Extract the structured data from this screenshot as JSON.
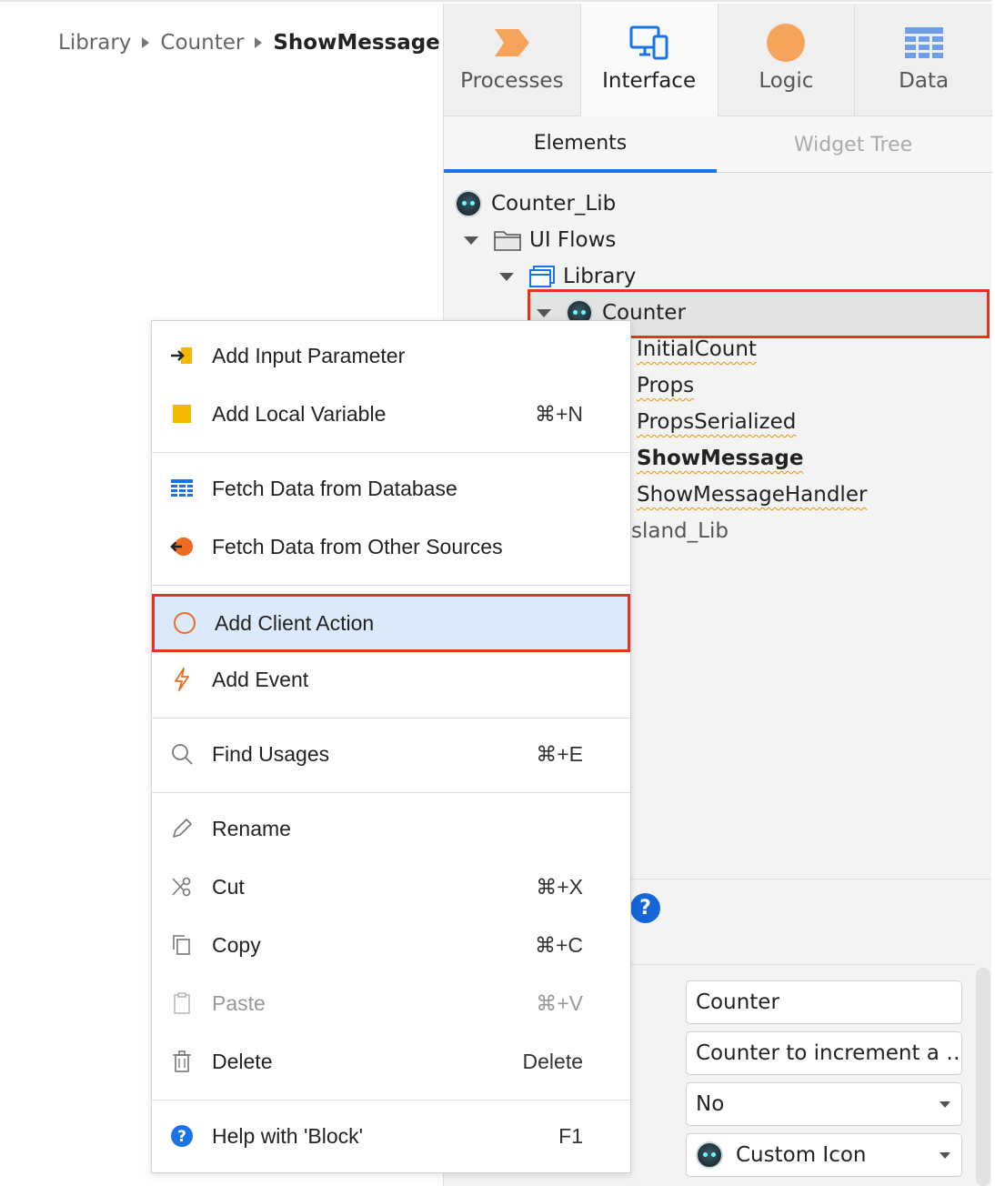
{
  "breadcrumb": {
    "items": [
      "Library",
      "Counter"
    ],
    "current": "ShowMessage"
  },
  "top_tabs": [
    {
      "label": "Processes",
      "icon": "processes-icon",
      "color": "#f6a35c"
    },
    {
      "label": "Interface",
      "icon": "interface-icon",
      "color": "#1a73e8"
    },
    {
      "label": "Logic",
      "icon": "logic-icon",
      "color": "#f6a35c"
    },
    {
      "label": "Data",
      "icon": "data-icon",
      "color": "#6f9ee8"
    }
  ],
  "sub_tabs": {
    "elements": "Elements",
    "widget_tree": "Widget Tree"
  },
  "tree": {
    "root": "Counter_Lib",
    "ui_flows": "UI Flows",
    "library": "Library",
    "counter": "Counter",
    "children": [
      "InitialCount",
      "Props",
      "PropsSerialized",
      "ShowMessage",
      "ShowMessageHandler"
    ],
    "island_lib": "sland_Lib"
  },
  "context_menu": {
    "add_input_parameter": "Add Input Parameter",
    "add_local_variable": "Add Local Variable",
    "add_local_variable_shortcut": "⌘+N",
    "fetch_db": "Fetch Data from Database",
    "fetch_other": "Fetch Data from Other Sources",
    "add_client_action": "Add Client Action",
    "add_event": "Add Event",
    "find_usages": "Find Usages",
    "find_usages_shortcut": "⌘+E",
    "rename": "Rename",
    "cut": "Cut",
    "cut_shortcut": "⌘+X",
    "copy": "Copy",
    "copy_shortcut": "⌘+C",
    "paste": "Paste",
    "paste_shortcut": "⌘+V",
    "delete": "Delete",
    "delete_shortcut": "Delete",
    "help": "Help with 'Block'",
    "help_shortcut": "F1"
  },
  "properties": {
    "help_glyph": "?",
    "name": "Counter",
    "description": "Counter to increment a …",
    "public": "No",
    "icon": "Custom Icon"
  },
  "colors": {
    "highlight_border": "#e8321f",
    "accent_blue": "#1a73e8",
    "selected_bg": "#dbeafb",
    "warning_orange": "#e69500"
  }
}
